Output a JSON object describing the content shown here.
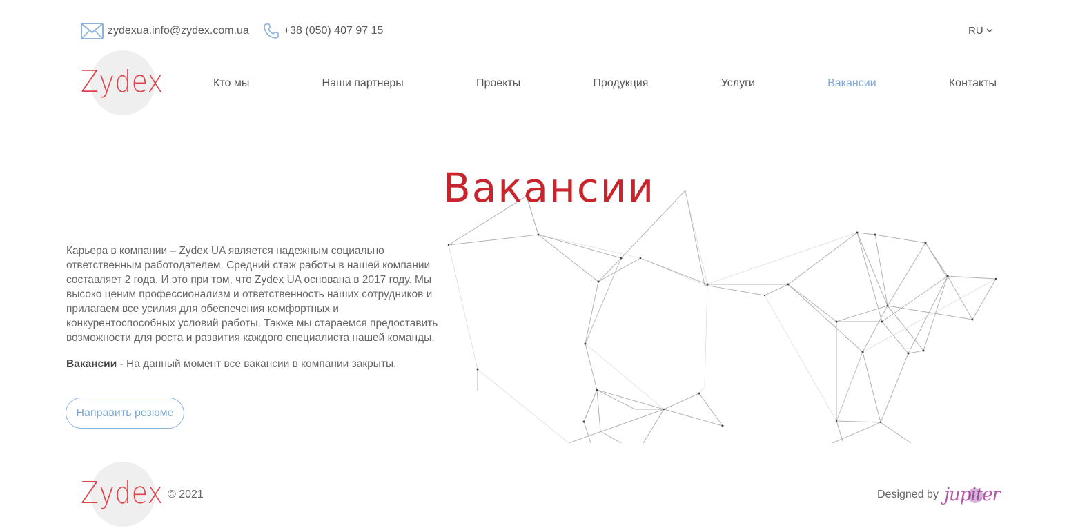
{
  "header": {
    "email": "zydexua.info@zydex.com.ua",
    "phone": "+38 (050) 407 97 15",
    "language": "RU",
    "logo_text": "Zydex"
  },
  "nav": {
    "items": [
      {
        "label": "Кто мы"
      },
      {
        "label": "Наши партнеры"
      },
      {
        "label": "Проекты"
      },
      {
        "label": "Продукция"
      },
      {
        "label": "Услуги"
      },
      {
        "label": "Вакансии",
        "active": true
      },
      {
        "label": "Контакты"
      }
    ]
  },
  "main": {
    "title": "Вакансии",
    "paragraph": "Карьера в компании – Zydex UA является надежным социально ответственным работодателем. Средний стаж работы в нашей компании составляет 2 года. И это при том, что Zydex UA основана в 2017 году. Мы высоко ценим профессионализм и ответственность наших сотрудников и прилагаем все усилия для обеспечения комфортных и конкурентоспособных условий работы. Также мы стараемся предоставить возможности для роста и развития каждого специалиста нашей команды.",
    "vacancies_label": "Вакансии",
    "vacancies_text": " - На данный момент все вакансии в компании закрыты.",
    "cv_button": "Направить резюме"
  },
  "footer": {
    "logo_text": "Zydex",
    "copyright": "© 2021",
    "designed_by": "Designed by",
    "designer_logo": "jupiter"
  },
  "colors": {
    "accent_red": "#c8242c",
    "logo_red": "#e0444a",
    "link_blue": "#7fa9d4"
  }
}
